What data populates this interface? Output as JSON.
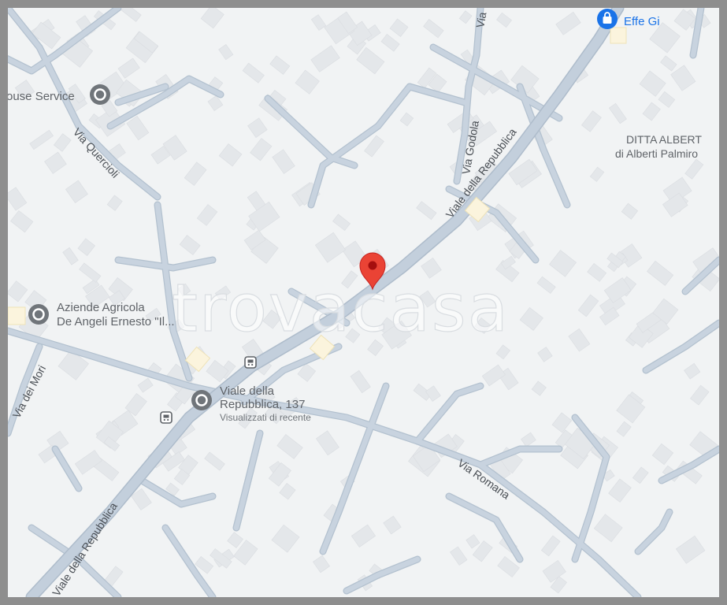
{
  "map": {
    "watermark": "trovacasa",
    "streets": {
      "viale_repubblica_ne": "Viale della Repubblica",
      "viale_repubblica_sw": "Viale della Repubblica",
      "via_godola": "Via Godola",
      "via_quercioli": "Via Quercioli",
      "via_dei_mori": "Via dei Mori",
      "via_romana": "Via Romana",
      "via_top": "Via"
    },
    "places": {
      "house_service": "ouse Service",
      "effe_gi": "Effe Gi",
      "ditta_line1": "DITTA ALBERT",
      "ditta_line2": "di Alberti Palmiro",
      "aziende_line1": "Aziende Agricola",
      "aziende_line2": "De Angeli Ernesto \"Il...",
      "address_line1": "Viale della",
      "address_line2": "Repubblica, 137",
      "recent": "Visualizzati di recente"
    },
    "colors": {
      "background": "#f1f3f4",
      "road": "#c3cfdc",
      "road_edge": "#aebccb",
      "building": "#e6e8eb",
      "pin": "#ea4335",
      "poi_grey": "#70757a",
      "shop_blue": "#1a73e8"
    },
    "icons": [
      "location-pin-icon",
      "place-marker-icon",
      "shopping-bag-icon",
      "bus-stop-icon"
    ]
  }
}
